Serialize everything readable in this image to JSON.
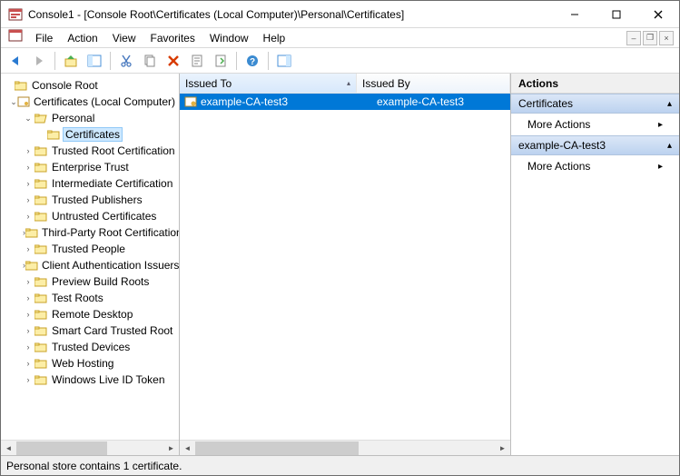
{
  "window": {
    "title": "Console1 - [Console Root\\Certificates (Local Computer)\\Personal\\Certificates]"
  },
  "menu": {
    "file": "File",
    "action": "Action",
    "view": "View",
    "favorites": "Favorites",
    "window": "Window",
    "help": "Help"
  },
  "tree": {
    "root": "Console Root",
    "certs": "Certificates (Local Computer)",
    "personal": "Personal",
    "certificates": "Certificates",
    "items": [
      "Trusted Root Certification",
      "Enterprise Trust",
      "Intermediate Certification",
      "Trusted Publishers",
      "Untrusted Certificates",
      "Third-Party Root Certification",
      "Trusted People",
      "Client Authentication Issuers",
      "Preview Build Roots",
      "Test Roots",
      "Remote Desktop",
      "Smart Card Trusted Root",
      "Trusted Devices",
      "Web Hosting",
      "Windows Live ID Token"
    ]
  },
  "list": {
    "headers": {
      "issued_to": "Issued To",
      "issued_by": "Issued By"
    },
    "rows": [
      {
        "issued_to": "example-CA-test3",
        "issued_by": "example-CA-test3"
      }
    ]
  },
  "actions": {
    "title": "Actions",
    "group1": "Certificates",
    "group2": "example-CA-test3",
    "more": "More Actions"
  },
  "status": "Personal store contains 1 certificate."
}
